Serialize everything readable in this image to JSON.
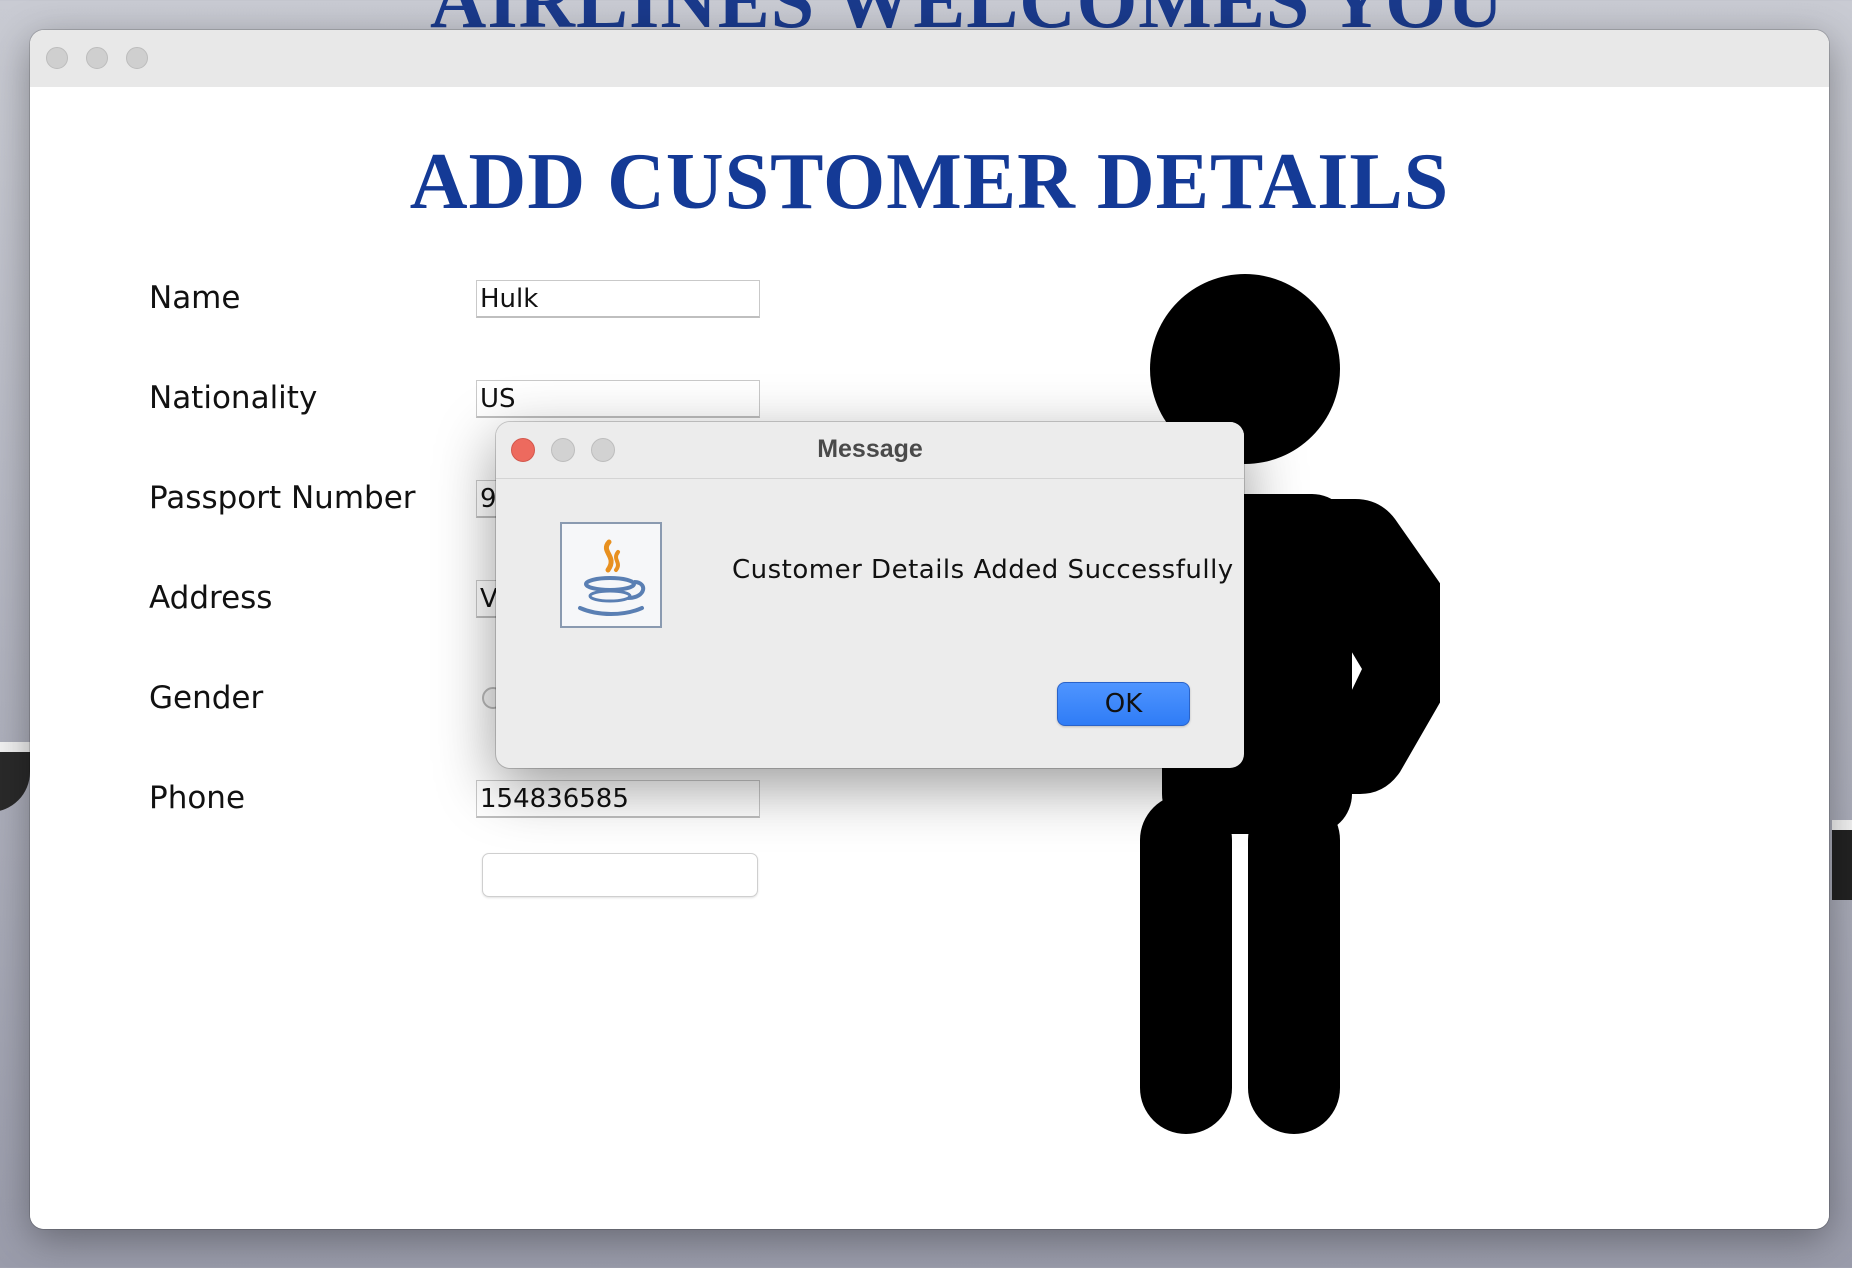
{
  "background": {
    "headline": "AIRLINES WELCOMES YOU"
  },
  "window": {
    "title": ""
  },
  "page": {
    "title": "ADD CUSTOMER DETAILS"
  },
  "form": {
    "fields": [
      {
        "label": "Name",
        "value": "Hulk"
      },
      {
        "label": "Nationality",
        "value": "US"
      },
      {
        "label": "Passport Number",
        "value": "9"
      },
      {
        "label": "Address",
        "value": "V"
      },
      {
        "label": "Gender",
        "value": ""
      },
      {
        "label": "Phone",
        "value": "154836585"
      }
    ],
    "save_label": ""
  },
  "dialog": {
    "title": "Message",
    "message": "Customer Details Added Successfully",
    "ok_label": "OK",
    "icon": "java-icon"
  },
  "colors": {
    "title_blue": "#143a96",
    "ok_blue": "#2f7cf6",
    "close_red": "#ed6a5e"
  }
}
